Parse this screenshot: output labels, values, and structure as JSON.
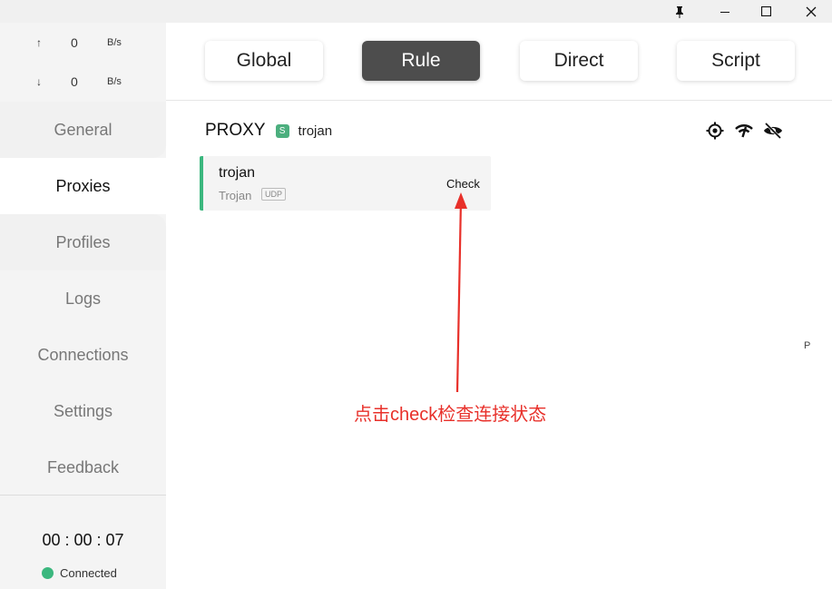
{
  "window": {
    "pin_icon": "pin-icon",
    "minimize_icon": "minimize-icon",
    "maximize_icon": "maximize-icon",
    "close_icon": "close-icon"
  },
  "traffic": {
    "up_arrow": "↑",
    "up_value": "0",
    "up_unit": "B/s",
    "down_arrow": "↓",
    "down_value": "0",
    "down_unit": "B/s"
  },
  "nav": {
    "general": "General",
    "proxies": "Proxies",
    "profiles": "Profiles",
    "logs": "Logs",
    "connections": "Connections",
    "settings": "Settings",
    "feedback": "Feedback",
    "active": "Proxies"
  },
  "footer": {
    "timer": "00 : 00 : 07",
    "status": "Connected",
    "status_color": "#3bb77e"
  },
  "modes": {
    "global": "Global",
    "rule": "Rule",
    "direct": "Direct",
    "script": "Script",
    "active": "Rule"
  },
  "group": {
    "name": "PROXY",
    "badge": "S",
    "selected": "trojan",
    "icons": [
      "locate-icon",
      "latency-test-icon",
      "hide-icon"
    ]
  },
  "proxy": {
    "name": "trojan",
    "type": "Trojan",
    "udp": "UDP",
    "check": "Check",
    "accent": "#3bb77e"
  },
  "edge_letter": "P",
  "annotation": {
    "text": "点击check检查连接状态",
    "color": "#e8302a"
  }
}
